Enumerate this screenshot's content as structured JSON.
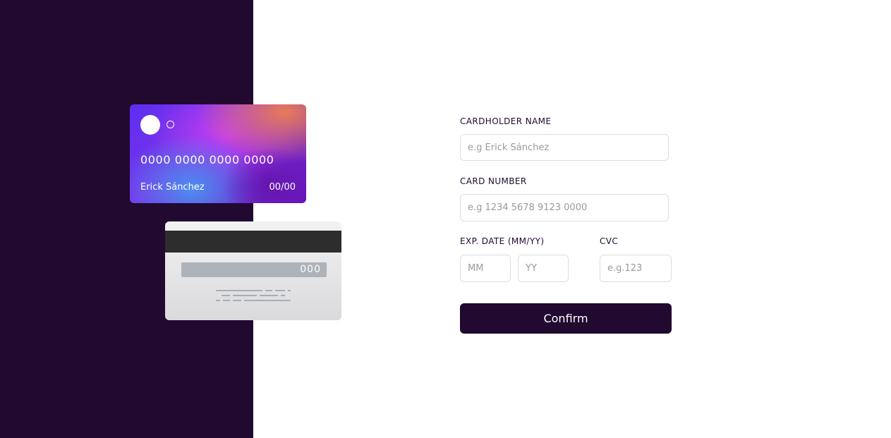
{
  "card_front": {
    "number": "0000 0000 0000 0000",
    "name": "Erick Sánchez",
    "expiry": "00/00"
  },
  "card_back": {
    "cvc": "000"
  },
  "form": {
    "cardholder_label": "CARDHOLDER NAME",
    "cardholder_placeholder": "e.g Erick Sánchez",
    "number_label": "CARD NUMBER",
    "number_placeholder": "e.g 1234 5678 9123 0000",
    "exp_label": "EXP. DATE (MM/YY)",
    "month_placeholder": "MM",
    "year_placeholder": "YY",
    "cvc_label": "CVC",
    "cvc_placeholder": "e.g.123",
    "confirm_label": "Confirm"
  },
  "colors": {
    "panel_bg": "#21092f",
    "accent": "#21092f",
    "input_border": "#dedddf"
  }
}
